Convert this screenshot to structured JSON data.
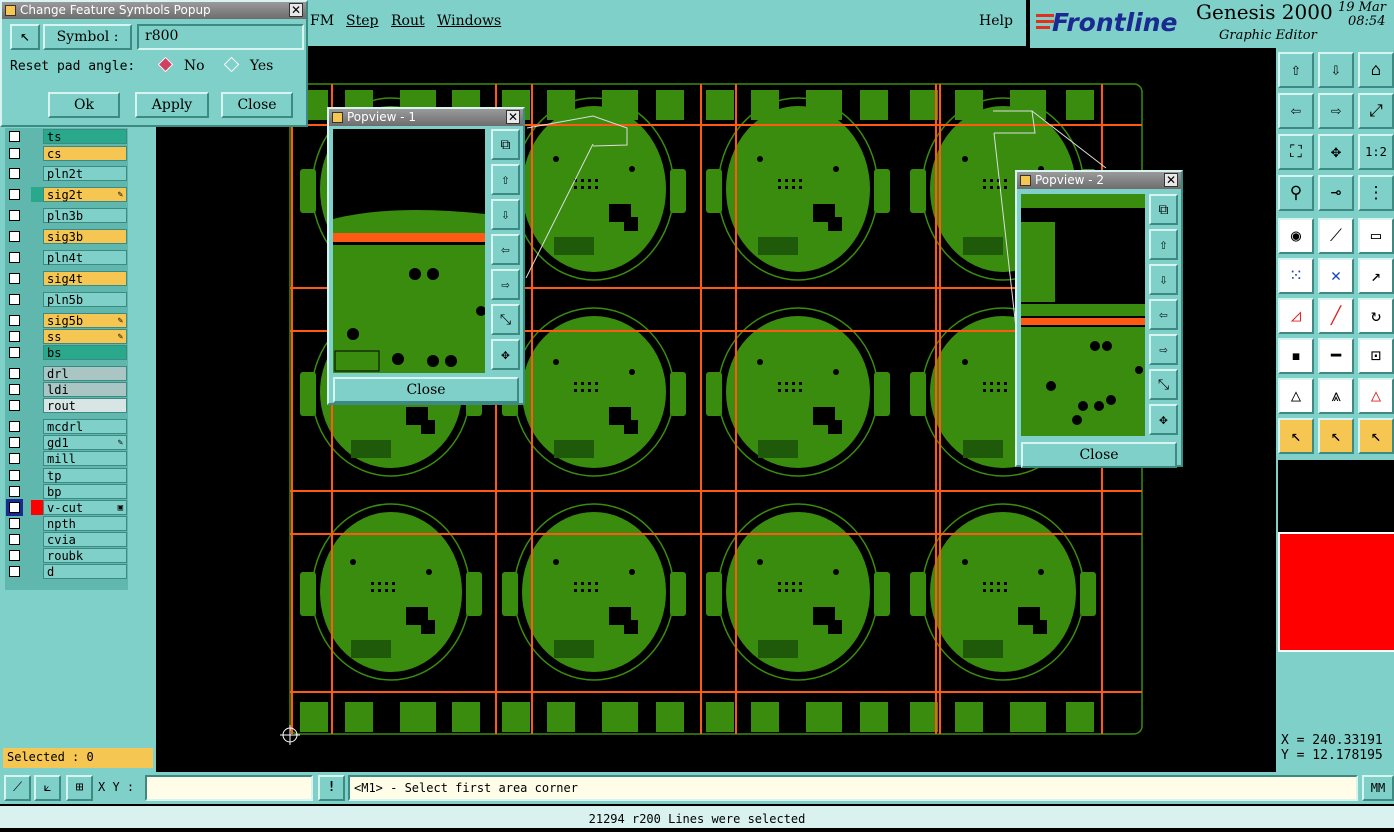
{
  "menubar": {
    "items": [
      "FM",
      "Step",
      "Rout",
      "Windows"
    ],
    "help": "Help"
  },
  "brand": {
    "logo": "Frontline",
    "product": "Genesis 2000",
    "subtitle": "Graphic Editor",
    "date": "19 Mar",
    "time": "08:54"
  },
  "symbol_popup": {
    "title": "Change Feature Symbols Popup",
    "symbol_label": "Symbol :",
    "symbol_value": "r800",
    "reset_label": "Reset pad angle:",
    "option_no": "No",
    "option_yes": "Yes",
    "ok": "Ok",
    "apply": "Apply",
    "close": "Close"
  },
  "layers": [
    {
      "name": "ts",
      "bg": "#2aa88c",
      "flag": ""
    },
    {
      "name": "cs",
      "bg": "#f6c653",
      "flag": ""
    },
    {
      "name": "pln2t",
      "bg": "#7fd0c8",
      "flag": ""
    },
    {
      "name": "sig2t",
      "bg": "#f6c653",
      "flag": "✎",
      "color": "#2aa88c"
    },
    {
      "name": "pln3b",
      "bg": "#7fd0c8",
      "flag": ""
    },
    {
      "name": "sig3b",
      "bg": "#f6c653",
      "flag": ""
    },
    {
      "name": "pln4t",
      "bg": "#7fd0c8",
      "flag": ""
    },
    {
      "name": "sig4t",
      "bg": "#f6c653",
      "flag": ""
    },
    {
      "name": "pln5b",
      "bg": "#7fd0c8",
      "flag": ""
    },
    {
      "name": "sig5b",
      "bg": "#f6c653",
      "flag": "✎"
    },
    {
      "name": "ss",
      "bg": "#f6c653",
      "flag": "✎"
    },
    {
      "name": "bs",
      "bg": "#2aa88c",
      "flag": ""
    },
    {
      "name": "drl",
      "bg": "#a9c6c4",
      "flag": ""
    },
    {
      "name": "ldi",
      "bg": "#a9c6c4",
      "flag": ""
    },
    {
      "name": "rout",
      "bg": "#d7e6e4",
      "flag": ""
    },
    {
      "name": "mcdrl",
      "bg": "#7fd0c8",
      "flag": ""
    },
    {
      "name": "gd1",
      "bg": "#7fd0c8",
      "flag": "✎"
    },
    {
      "name": "mill",
      "bg": "#7fd0c8",
      "flag": ""
    },
    {
      "name": "tp",
      "bg": "#7fd0c8",
      "flag": ""
    },
    {
      "name": "bp",
      "bg": "#7fd0c8",
      "flag": ""
    },
    {
      "name": "v-cut",
      "bg": "#7fd0c8",
      "flag": "▣",
      "color": "#ff0000",
      "active": true
    },
    {
      "name": "npth",
      "bg": "#7fd0c8",
      "flag": ""
    },
    {
      "name": "cvia",
      "bg": "#7fd0c8",
      "flag": ""
    },
    {
      "name": "roubk",
      "bg": "#7fd0c8",
      "flag": ""
    },
    {
      "name": "d",
      "bg": "#7fd0c8",
      "flag": ""
    }
  ],
  "selected_label": "Selected : 0",
  "popview1": {
    "title": "Popview - 1",
    "close": "Close"
  },
  "popview2": {
    "title": "Popview - 2",
    "close": "Close"
  },
  "coords": {
    "x": "X = 240.33191",
    "y": "Y = 12.178195"
  },
  "cmdbar": {
    "xy_label": "X Y :",
    "xy_value": "",
    "prompt": "<M1> - Select first area corner",
    "units": "MM"
  },
  "status": "21294 r200 Lines were selected",
  "toolbar_icons": [
    "zoom-home-icon",
    "pan-down-icon",
    "home-icon",
    "pan-left-icon",
    "pan-right-icon",
    "zoom-ratio-icon",
    "fit-screen-icon",
    "fit-profile-icon",
    "scale-1-2-icon",
    "measure-icon",
    "snap-icon",
    "net-icon",
    "pad-icon",
    "line-icon",
    "ruler-icon",
    "connect-icon",
    "cross-icon",
    "arc-icon",
    "draw-angle-icon",
    "draw-line-icon",
    "rotate-icon",
    "pad-select-icon",
    "split-icon",
    "box-select-icon",
    "triangle-icon",
    "triangle-up-icon",
    "triangle-red-icon",
    "pointer-icon",
    "pointer-box-icon",
    "pointer-circle-icon"
  ],
  "colors": {
    "panel": "#7fd0c8",
    "board": "#3a8c0e",
    "cut": "#ff5a14",
    "accent": "#f6c653"
  }
}
